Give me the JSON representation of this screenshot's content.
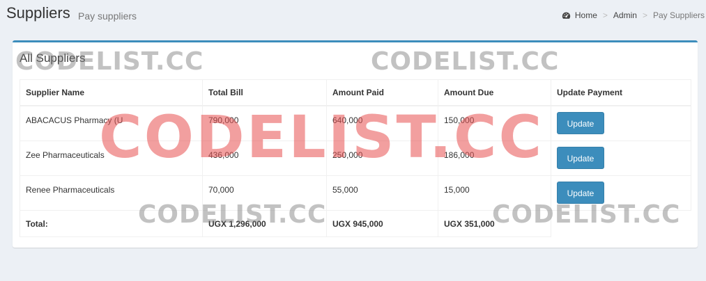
{
  "header": {
    "title": "Suppliers",
    "subtitle": "Pay suppliers"
  },
  "breadcrumb": {
    "icon": "dashboard-icon",
    "items": [
      "Home",
      "Admin",
      "Pay Suppliers"
    ]
  },
  "box": {
    "title": "All Suppliers",
    "accent_color": "#3c8dbc"
  },
  "table": {
    "columns": [
      "Supplier Name",
      "Total Bill",
      "Amount Paid",
      "Amount Due",
      "Update Payment"
    ],
    "rows": [
      {
        "name": "ABACACUS Pharmacy (U",
        "total_bill": "790,000",
        "amount_paid": "640,000",
        "amount_due": "150,000",
        "action": "Update"
      },
      {
        "name": "Zee Pharmaceuticals",
        "total_bill": "436,000",
        "amount_paid": "250,000",
        "amount_due": "186,000",
        "action": "Update"
      },
      {
        "name": "Renee Pharmaceuticals",
        "total_bill": "70,000",
        "amount_paid": "55,000",
        "amount_due": "15,000",
        "action": "Update"
      }
    ],
    "totals": {
      "label": "Total:",
      "total_bill": "UGX 1,296,000",
      "amount_paid": "UGX 945,000",
      "amount_due": "UGX 351,000"
    }
  },
  "watermark": {
    "text": "CODELIST.CC"
  }
}
